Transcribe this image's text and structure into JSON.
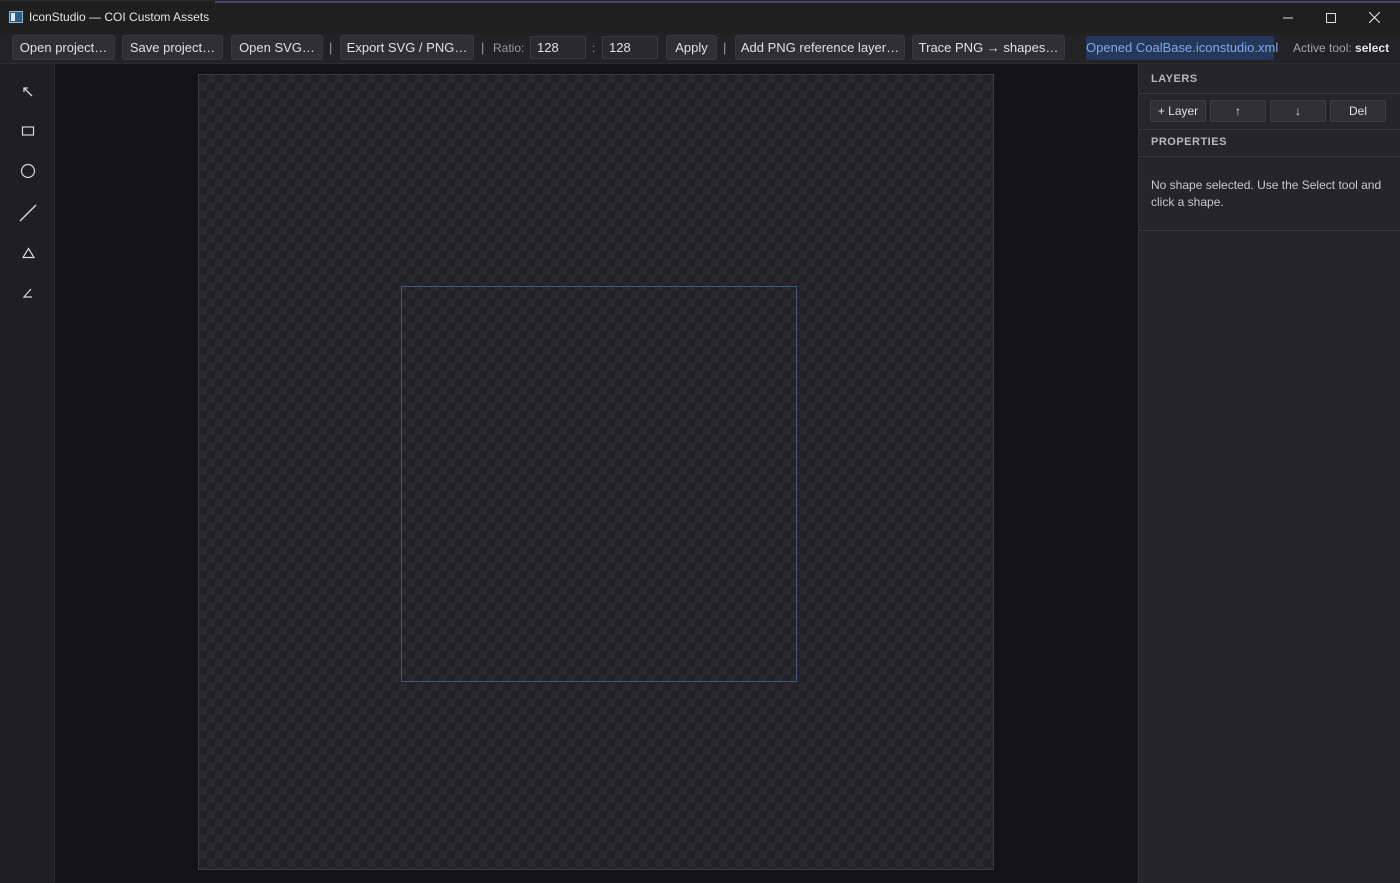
{
  "window": {
    "title": "IconStudio — COI Custom Assets"
  },
  "toolbar": {
    "open_project": "Open project…",
    "save_project": "Save project…",
    "open_svg": "Open SVG…",
    "separator": "|",
    "export": "Export SVG / PNG…",
    "ratio_label": "Ratio:",
    "ratio_width": "128",
    "ratio_colon": ":",
    "ratio_height": "128",
    "apply": "Apply",
    "add_png_ref": "Add PNG reference layer…",
    "trace_png": "Trace PNG → shapes…",
    "status": "Opened CoalBase.iconstudio.xml",
    "active_tool_label": "Active tool:",
    "active_tool_value": "select"
  },
  "tools": [
    {
      "name": "select-tool",
      "icon": "arrow-icon"
    },
    {
      "name": "rectangle-tool",
      "icon": "rectangle-icon"
    },
    {
      "name": "ellipse-tool",
      "icon": "circle-icon"
    },
    {
      "name": "line-tool",
      "icon": "line-icon"
    },
    {
      "name": "triangle-tool",
      "icon": "triangle-icon"
    },
    {
      "name": "angle-tool",
      "icon": "angle-icon"
    }
  ],
  "layers_panel": {
    "title": "LAYERS",
    "add_layer": "+ Layer",
    "move_up": "↑",
    "move_down": "↓",
    "delete": "Del"
  },
  "properties_panel": {
    "title": "PROPERTIES",
    "empty_message": "No shape selected. Use the Select tool and click a shape."
  },
  "colors": {
    "accent": "#3c5a86",
    "status_text": "#7fa9e8",
    "status_bg": "#25375a"
  }
}
